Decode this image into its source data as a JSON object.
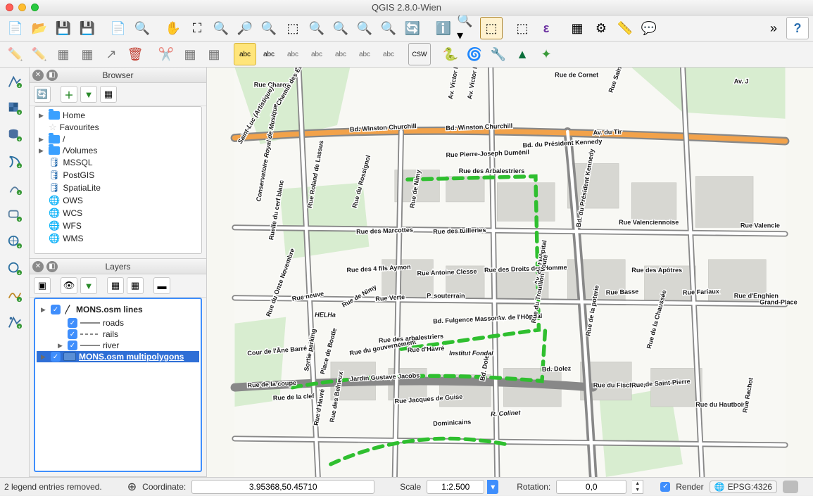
{
  "window": {
    "title": "QGIS 2.8.0-Wien"
  },
  "panels": {
    "browser": {
      "title": "Browser",
      "items": [
        {
          "label": "Home",
          "icon": "folder",
          "expandable": true
        },
        {
          "label": "Favourites",
          "icon": "star",
          "expandable": false
        },
        {
          "label": "/",
          "icon": "folder",
          "expandable": true
        },
        {
          "label": "/Volumes",
          "icon": "folder",
          "expandable": true
        },
        {
          "label": "MSSQL",
          "icon": "db",
          "expandable": false
        },
        {
          "label": "PostGIS",
          "icon": "db",
          "expandable": false
        },
        {
          "label": "SpatiaLite",
          "icon": "db",
          "expandable": false
        },
        {
          "label": "OWS",
          "icon": "globe",
          "expandable": false
        },
        {
          "label": "WCS",
          "icon": "globe",
          "expandable": false
        },
        {
          "label": "WFS",
          "icon": "globe",
          "expandable": false
        },
        {
          "label": "WMS",
          "icon": "globe",
          "expandable": false
        }
      ]
    },
    "layers": {
      "title": "Layers",
      "items": [
        {
          "label": "MONS.osm lines",
          "checked": true,
          "expandable": true,
          "bold": true,
          "type": "group",
          "indent": 0
        },
        {
          "label": "roads",
          "checked": true,
          "type": "line",
          "indent": 1
        },
        {
          "label": "rails",
          "checked": true,
          "type": "dash",
          "indent": 1
        },
        {
          "label": "river",
          "checked": true,
          "type": "line",
          "indent": 1,
          "expandable": true
        },
        {
          "label": "MONS.osm multipolygons",
          "checked": true,
          "type": "poly",
          "selected": true,
          "bold": true,
          "underline": true,
          "indent": 0,
          "expandable": true
        }
      ]
    }
  },
  "map": {
    "roads": [
      "Rue Charon",
      "Chemin des Étangs",
      "Av. Victor Maistria",
      "Av. Victor Maistria",
      "Rue de Cornet",
      "Rue Saint-Lazare",
      "Av. J",
      "Bd. Winston Churchill",
      "Bd. Winston Churchill",
      "Bd. du Président Kennedy",
      "Av. du Tir",
      "Rue Pierre-Joseph Duménil",
      "Rue Roland de Lassus",
      "Rue du Rossignol",
      "Rue de Nimy",
      "Rue des Arbalestriers",
      "Ruelle du cerf blanc",
      "Rue des Marcottes",
      "Rue des tuilleries",
      "Bd. du Président Kennedy",
      "Rue Valenciennoise",
      "Rue Valencie",
      "Rue des 4 fils Aymon",
      "Rue Antoine Clesse",
      "Rue des Droits de l'Homme",
      "Rue des Apôtres",
      "Rue du Onze Novembre",
      "Rue neuve",
      "Rue de Nimy",
      "Rue Verte",
      "P. souterrain",
      "Av. de l'Hôpital",
      "Av. de l'Hôpital",
      "Rue Basse",
      "Rue Fariaux",
      "Rue d'Enghien",
      "Grand-Place",
      "Cour de l'Âne Barré",
      "Sortie parking",
      "Place de Bootle",
      "Rue du gouvernement",
      "Rue des arbalestriers",
      "Bd. Fulgence Masson",
      "Rue du Trouillon Vouté",
      "Rue de la poterie",
      "Rue de la Chaussée",
      "Rue de la coupe",
      "Rue de la clef",
      "Rue d'Havré",
      "Rue des Belneux",
      "Jardin Gustave Jacobs",
      "Rue d'Havré",
      "Bd. Dolez",
      "Bd. Dolez",
      "Rue du Fisch Club",
      "Rue de Saint-Pierre",
      "Rue du Hautbois",
      "Rue Rachot",
      "Rue Jacques de Guise",
      "Dominicains",
      "R. Colinet",
      "Conservatoire Royal de Musique",
      "Saint-Luc (Artistique)",
      "HELHa",
      "Institut Fondal"
    ]
  },
  "statusbar": {
    "message": "2 legend entries removed.",
    "coord_label": "Coordinate:",
    "coord_value": "3.95368,50.45710",
    "scale_label": "Scale",
    "scale_value": "1:2.500",
    "rotation_label": "Rotation:",
    "rotation_value": "0,0",
    "render_label": "Render",
    "crs": "EPSG:4326"
  }
}
